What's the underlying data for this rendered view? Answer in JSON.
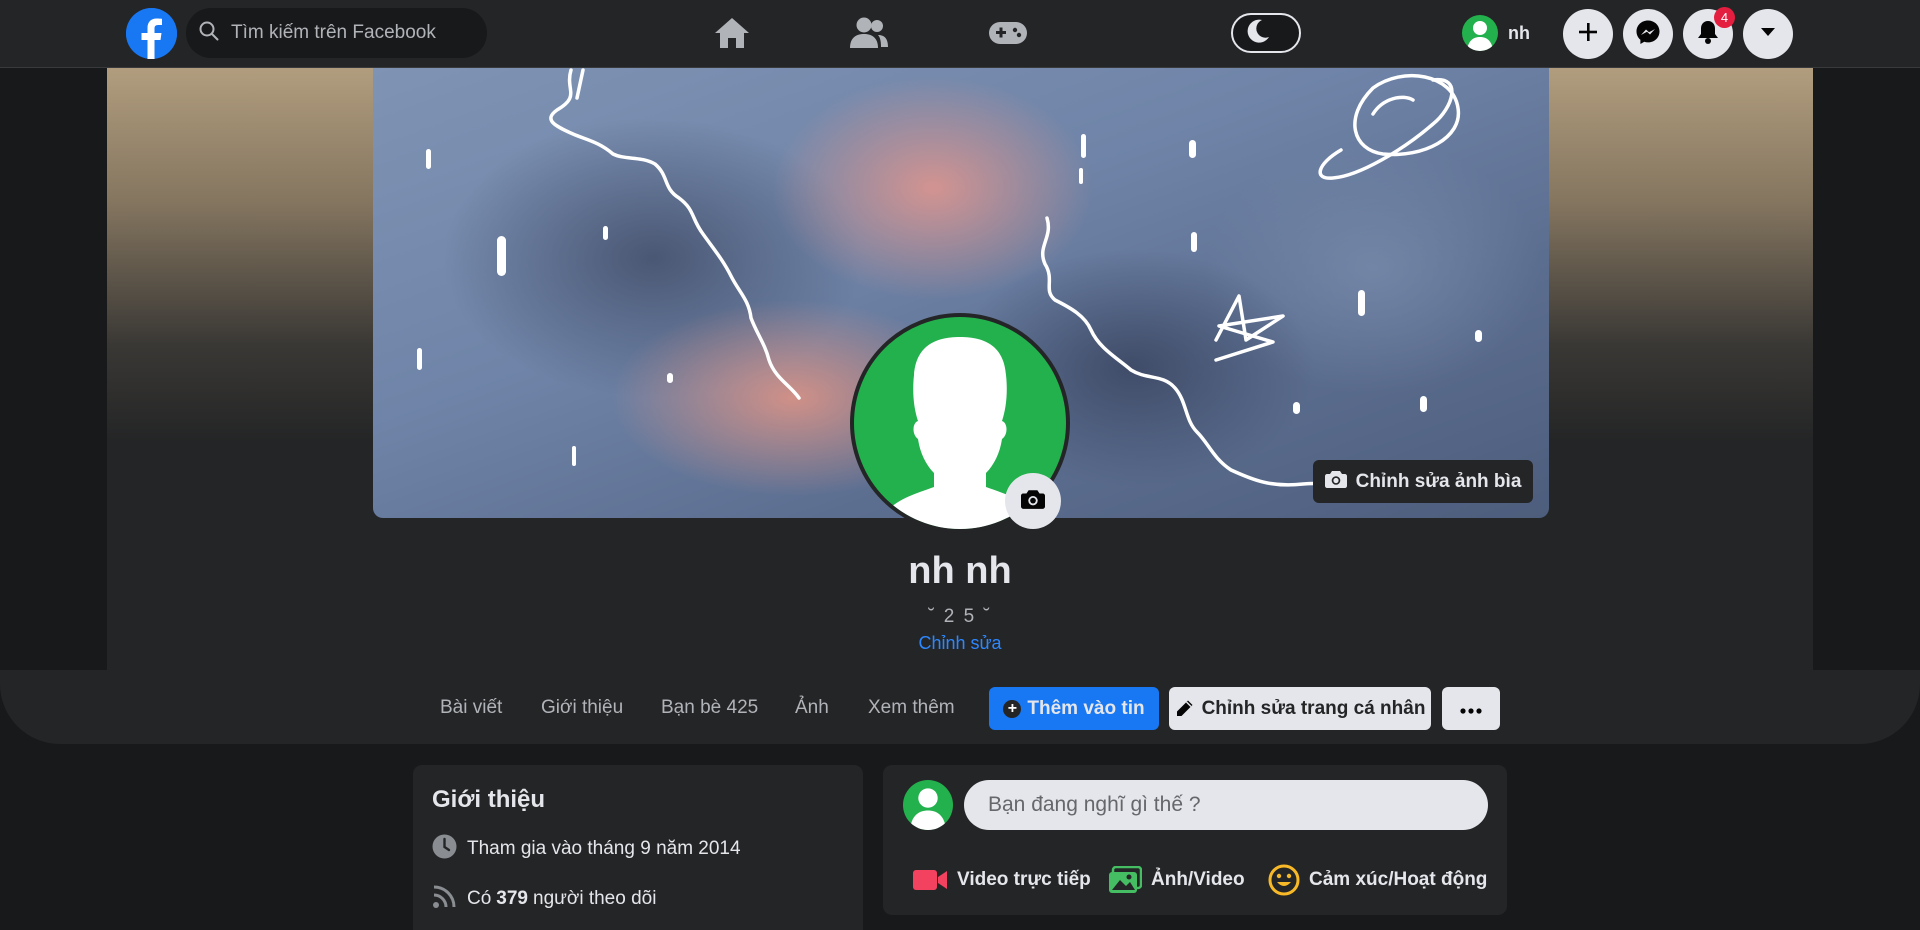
{
  "topbar": {
    "search_placeholder": "Tìm kiếm trên Facebook",
    "user_name": "nh",
    "notification_count": "4",
    "icons": [
      "facebook-logo-icon",
      "search-icon",
      "home-icon",
      "friends-icon",
      "gaming-icon",
      "moon-icon",
      "plus-icon",
      "messenger-icon",
      "bell-icon",
      "caret-down-icon"
    ]
  },
  "profile": {
    "name": "nh nh",
    "bio": "˘ 2 5 ˘",
    "bio_edit_label": "Chỉnh sửa",
    "cover_edit_label": "Chỉnh sửa ảnh bìa"
  },
  "tabs": {
    "items": [
      "Bài viết",
      "Giới thiệu",
      "Bạn bè 425",
      "Ảnh",
      "Xem thêm"
    ],
    "add_story_label": "Thêm vào tin",
    "edit_profile_label": "Chỉnh sửa trang cá nhân",
    "more_label": "···"
  },
  "intro": {
    "title": "Giới thiệu",
    "joined": "Tham gia vào tháng 9 năm 2014",
    "followers_prefix": "Có",
    "followers_count": "379",
    "followers_suffix": "người theo dõi"
  },
  "composer": {
    "placeholder": "Bạn đang nghĩ gì thế ?",
    "actions": [
      "Video trực tiếp",
      "Ảnh/Video",
      "Cảm xúc/Hoạt động"
    ]
  },
  "colors": {
    "page_bg": "#18191a",
    "surface": "#242526",
    "accent": "#1877f2",
    "link": "#2d88ff",
    "avatar_green": "#23b14d",
    "badge_red": "#e41e3f",
    "live_red": "#f3425f",
    "photo_green": "#45bd62",
    "feeling_yellow": "#f7b928"
  }
}
